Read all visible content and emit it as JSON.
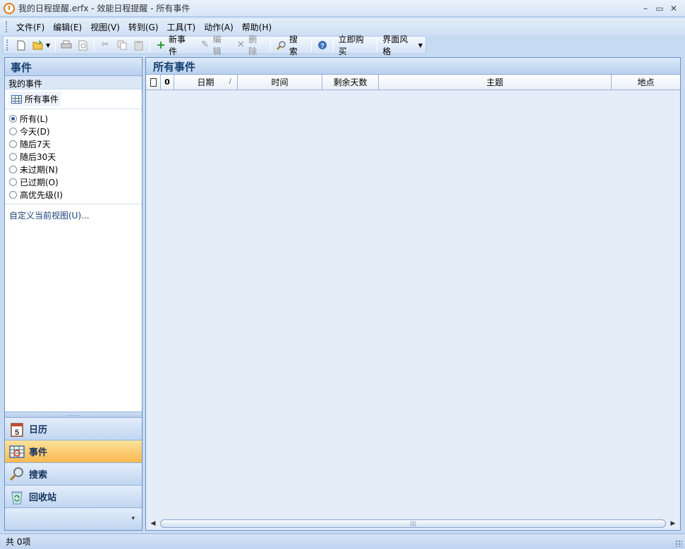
{
  "window": {
    "title": "我的日程提醒.erfx - 效能日程提醒 - 所有事件",
    "minimize": "–",
    "restore": "▭",
    "close": "✕"
  },
  "menu": {
    "items": [
      "文件(F)",
      "编辑(E)",
      "视图(V)",
      "转到(G)",
      "工具(T)",
      "动作(A)",
      "帮助(H)"
    ]
  },
  "toolbar": {
    "new_event": "新事件",
    "edit": "编辑",
    "delete": "删除",
    "search": "搜索",
    "buy_now": "立即购买",
    "ui_style": "界面风格"
  },
  "left_panel": {
    "title": "事件",
    "group": "我的事件",
    "current_view": "所有事件",
    "filters": [
      {
        "label": "所有(L)",
        "checked": true
      },
      {
        "label": "今天(D)",
        "checked": false
      },
      {
        "label": "随后7天",
        "checked": false
      },
      {
        "label": "随后30天",
        "checked": false
      },
      {
        "label": "未过期(N)",
        "checked": false
      },
      {
        "label": "已过期(O)",
        "checked": false
      },
      {
        "label": "高优先级(I)",
        "checked": false
      }
    ],
    "customize": "自定义当前视图(U)...",
    "splitter_dots": "......",
    "nav": {
      "calendar": "日历",
      "events": "事件",
      "search": "搜索",
      "recycle": "回收站"
    },
    "calendar_icon_number": "5"
  },
  "main": {
    "title": "所有事件",
    "columns": {
      "date": "日期",
      "time": "时间",
      "days_left": "剩余天数",
      "subject": "主题",
      "location": "地点"
    },
    "sort_indicator": "/",
    "scroll_thumb": "|||"
  },
  "status": {
    "count": "共 0项"
  }
}
